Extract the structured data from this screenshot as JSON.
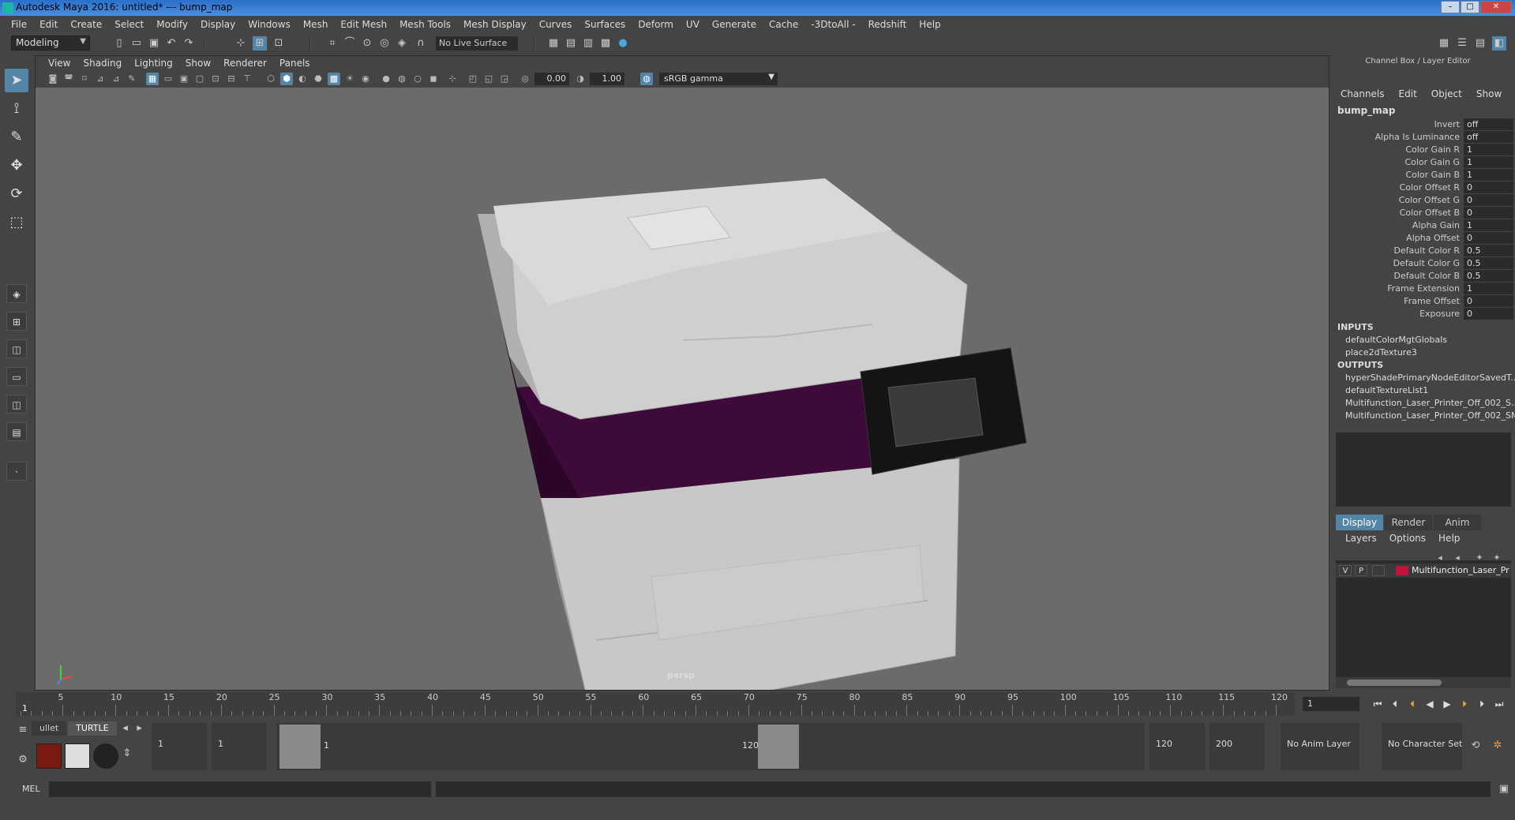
{
  "window": {
    "title": "Autodesk Maya 2016: untitled*   ---   bump_map",
    "min_label": "–",
    "max_label": "□",
    "close_label": "✕"
  },
  "menubar": [
    "File",
    "Edit",
    "Create",
    "Select",
    "Modify",
    "Display",
    "Windows",
    "Mesh",
    "Edit Mesh",
    "Mesh Tools",
    "Mesh Display",
    "Curves",
    "Surfaces",
    "Deform",
    "UV",
    "Generate",
    "Cache",
    "-3DtoAll -",
    "Redshift",
    "Help"
  ],
  "statusline": {
    "mode": "Modeling",
    "live_surface": "No Live Surface"
  },
  "viewport": {
    "menu": [
      "View",
      "Shading",
      "Lighting",
      "Show",
      "Renderer",
      "Panels"
    ],
    "exposure": "0.00",
    "gamma": "1.00",
    "color_space": "sRGB gamma",
    "camera": "persp"
  },
  "channel_box": {
    "title": "Channel Box / Layer Editor",
    "menu": [
      "Channels",
      "Edit",
      "Object",
      "Show"
    ],
    "node": "bump_map",
    "attributes": [
      {
        "label": "Invert",
        "value": "off"
      },
      {
        "label": "Alpha Is Luminance",
        "value": "off"
      },
      {
        "label": "Color Gain R",
        "value": "1"
      },
      {
        "label": "Color Gain G",
        "value": "1"
      },
      {
        "label": "Color Gain B",
        "value": "1"
      },
      {
        "label": "Color Offset R",
        "value": "0"
      },
      {
        "label": "Color Offset G",
        "value": "0"
      },
      {
        "label": "Color Offset B",
        "value": "0"
      },
      {
        "label": "Alpha Gain",
        "value": "1"
      },
      {
        "label": "Alpha Offset",
        "value": "0"
      },
      {
        "label": "Default Color R",
        "value": "0.5"
      },
      {
        "label": "Default Color G",
        "value": "0.5"
      },
      {
        "label": "Default Color B",
        "value": "0.5"
      },
      {
        "label": "Frame Extension",
        "value": "1"
      },
      {
        "label": "Frame Offset",
        "value": "0"
      },
      {
        "label": "Exposure",
        "value": "0"
      }
    ],
    "inputs_label": "INPUTS",
    "inputs": [
      "defaultColorMgtGlobals",
      "place2dTexture3"
    ],
    "outputs_label": "OUTPUTS",
    "outputs": [
      "hyperShadePrimaryNodeEditorSavedT...",
      "defaultTextureList1",
      "Multifunction_Laser_Printer_Off_002_S...",
      "Multifunction_Laser_Printer_Off_002_SM"
    ]
  },
  "layer_editor": {
    "tabs": [
      "Display",
      "Render",
      "Anim"
    ],
    "active_tab": "Display",
    "menu": [
      "Layers",
      "Options",
      "Help"
    ],
    "layers": [
      {
        "v": "V",
        "p": "P",
        "name": "Multifunction_Laser_Prir",
        "color": "#c0143c"
      }
    ]
  },
  "timeline": {
    "ticks": [
      "5",
      "10",
      "15",
      "20",
      "25",
      "30",
      "35",
      "40",
      "45",
      "50",
      "55",
      "60",
      "65",
      "70",
      "75",
      "80",
      "85",
      "90",
      "95",
      "100",
      "105",
      "110",
      "115",
      "120"
    ],
    "current": "1",
    "current_frame_field": "1"
  },
  "range": {
    "shelf_tabs": [
      "ullet",
      "TURTLE"
    ],
    "start": "1",
    "playback_start": "1",
    "range_start_label": "1",
    "range_end_label": "120",
    "playback_end": "120",
    "end": "200",
    "anim_layer": "No Anim Layer",
    "character_set": "No Character Set"
  },
  "command": {
    "label": "MEL"
  },
  "colors": {
    "accent": "#5285a6",
    "printer_purple": "#3e0a3a",
    "viewport_bg": "#6b6b6b"
  }
}
